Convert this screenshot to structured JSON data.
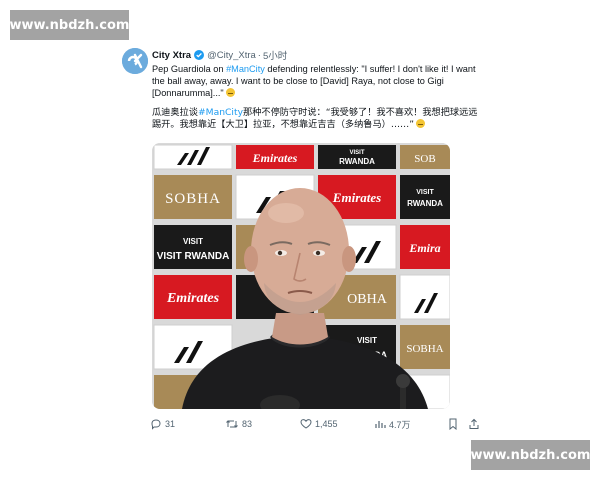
{
  "watermark": {
    "top": "www.nbdzh.com",
    "bottom": "www.nbdzh.com"
  },
  "tweet": {
    "display_name": "City Xtra",
    "handle": "@City_Xtra",
    "separator": "·",
    "time": "5小时",
    "text_en_1": "Pep Guardiola on ",
    "hashtag": "#ManCity",
    "text_en_2": " defending relentlessly: \"I suffer! I don't like it! I want the ball away, away. I want to be close to [David] Raya, not close to Gigi [Donnarumma]...\"",
    "text_zh_1": "瓜迪奥拉谈",
    "text_zh_2": "那种不停防守时说：“我受够了！我不喜欢！我想把球远远踢开。我想靠近【大卫】拉亚，不想靠近吉吉（多纳鲁马）……”",
    "emoji": "crying-face",
    "accent_color": "#1d9bf0"
  },
  "photo": {
    "ad_boards": [
      "adidas",
      "Emirates",
      "VISIT RWANDA",
      "SOBHA"
    ],
    "brand_colors": {
      "emirates": "#d71921",
      "rwanda": "#1a1a1a",
      "sobha": "#a88a57",
      "adidas": "#ffffff"
    }
  },
  "actions": {
    "replies": "31",
    "retweets": "83",
    "likes": "1,455",
    "views": "4.7万"
  }
}
